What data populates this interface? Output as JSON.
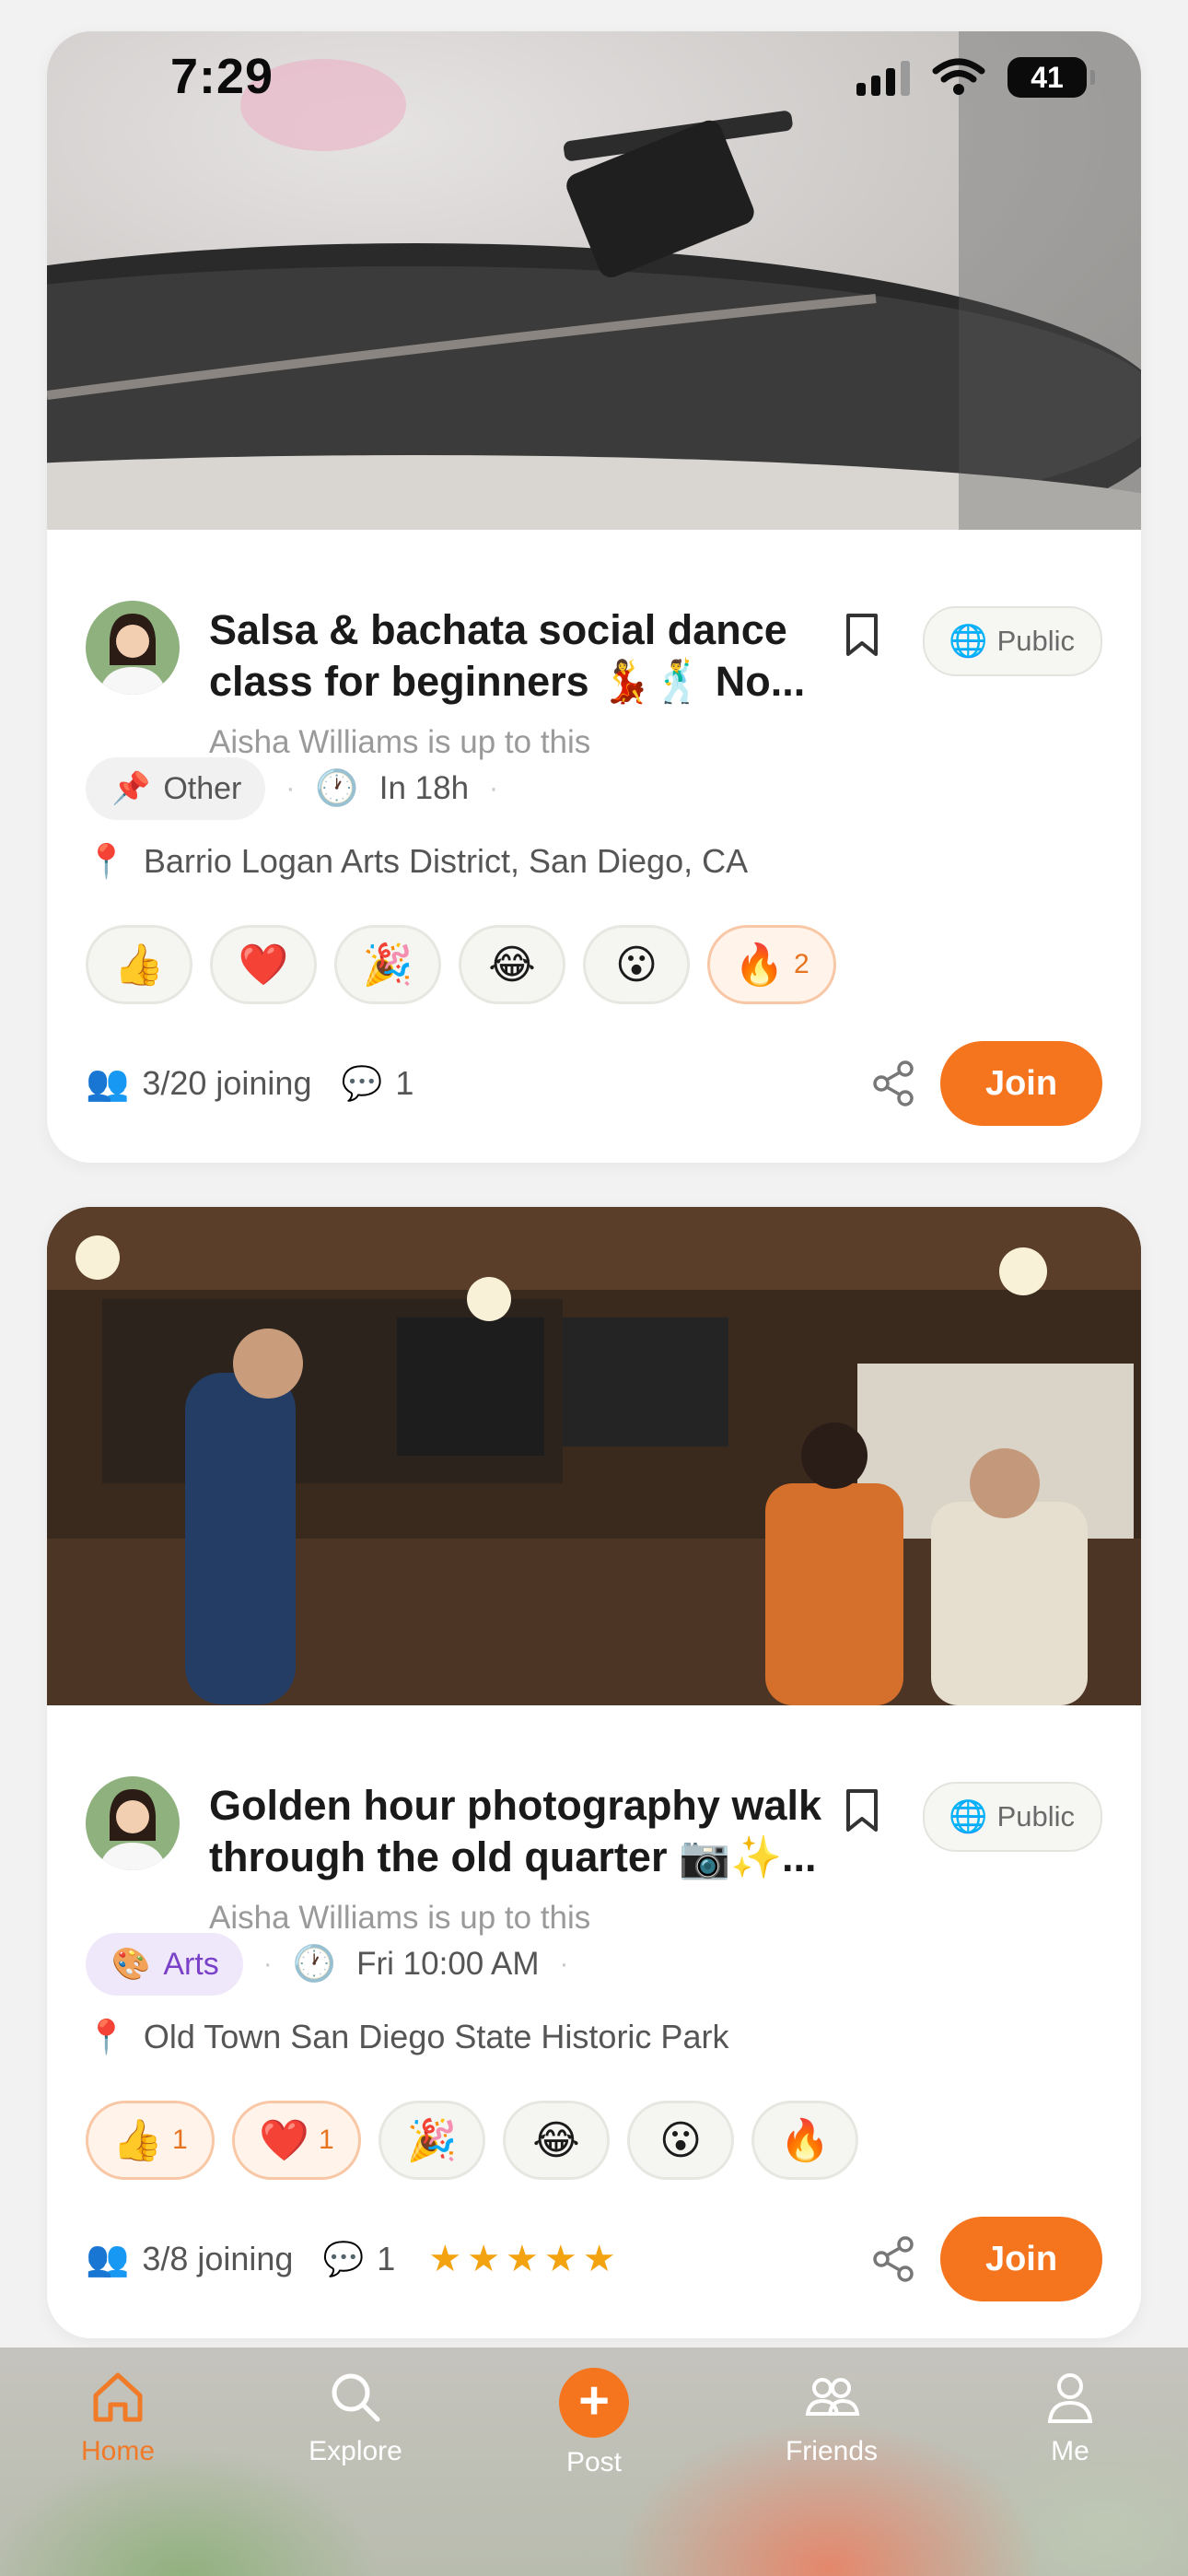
{
  "status_bar": {
    "time": "7:29",
    "battery": "41"
  },
  "posts": [
    {
      "title": "Salsa & bachata social dance class for beginners 💃🕺 No...",
      "host_line": "Aisha Williams is up to this",
      "visibility": "Public",
      "category": {
        "icon": "📌",
        "label": "Other"
      },
      "time": "In 18h",
      "location": "Barrio Logan Arts District, San Diego, CA",
      "reactions": [
        {
          "emoji": "👍",
          "count": ""
        },
        {
          "emoji": "❤️",
          "count": ""
        },
        {
          "emoji": "🎉",
          "count": ""
        },
        {
          "emoji": "😂",
          "count": ""
        },
        {
          "emoji": "😮",
          "count": ""
        },
        {
          "emoji": "🔥",
          "count": "2"
        }
      ],
      "joining": "3/20 joining",
      "comments": "1",
      "rating": "",
      "join_label": "Join"
    },
    {
      "title": "Golden hour photography walk through the old quarter 📷✨...",
      "host_line": "Aisha Williams is up to this",
      "visibility": "Public",
      "category": {
        "icon": "🎨",
        "label": "Arts"
      },
      "time": "Fri 10:00 AM",
      "location": "Old Town San Diego State Historic Park",
      "reactions": [
        {
          "emoji": "👍",
          "count": "1"
        },
        {
          "emoji": "❤️",
          "count": "1"
        },
        {
          "emoji": "🎉",
          "count": ""
        },
        {
          "emoji": "😂",
          "count": ""
        },
        {
          "emoji": "😮",
          "count": ""
        },
        {
          "emoji": "🔥",
          "count": ""
        }
      ],
      "joining": "3/8 joining",
      "comments": "1",
      "rating": "★★★★★",
      "join_label": "Join"
    }
  ],
  "tabbar": {
    "items": [
      {
        "label": "Home",
        "icon": "home-icon",
        "active": true
      },
      {
        "label": "Explore",
        "icon": "search-icon",
        "active": false
      },
      {
        "label": "Post",
        "icon": "plus-icon",
        "active": false
      },
      {
        "label": "Friends",
        "icon": "friends-icon",
        "active": false
      },
      {
        "label": "Me",
        "icon": "person-icon",
        "active": false
      }
    ]
  },
  "colors": {
    "accent": "#f5741e",
    "arts_tag": "#7a40c8",
    "star": "#f2a30f"
  }
}
